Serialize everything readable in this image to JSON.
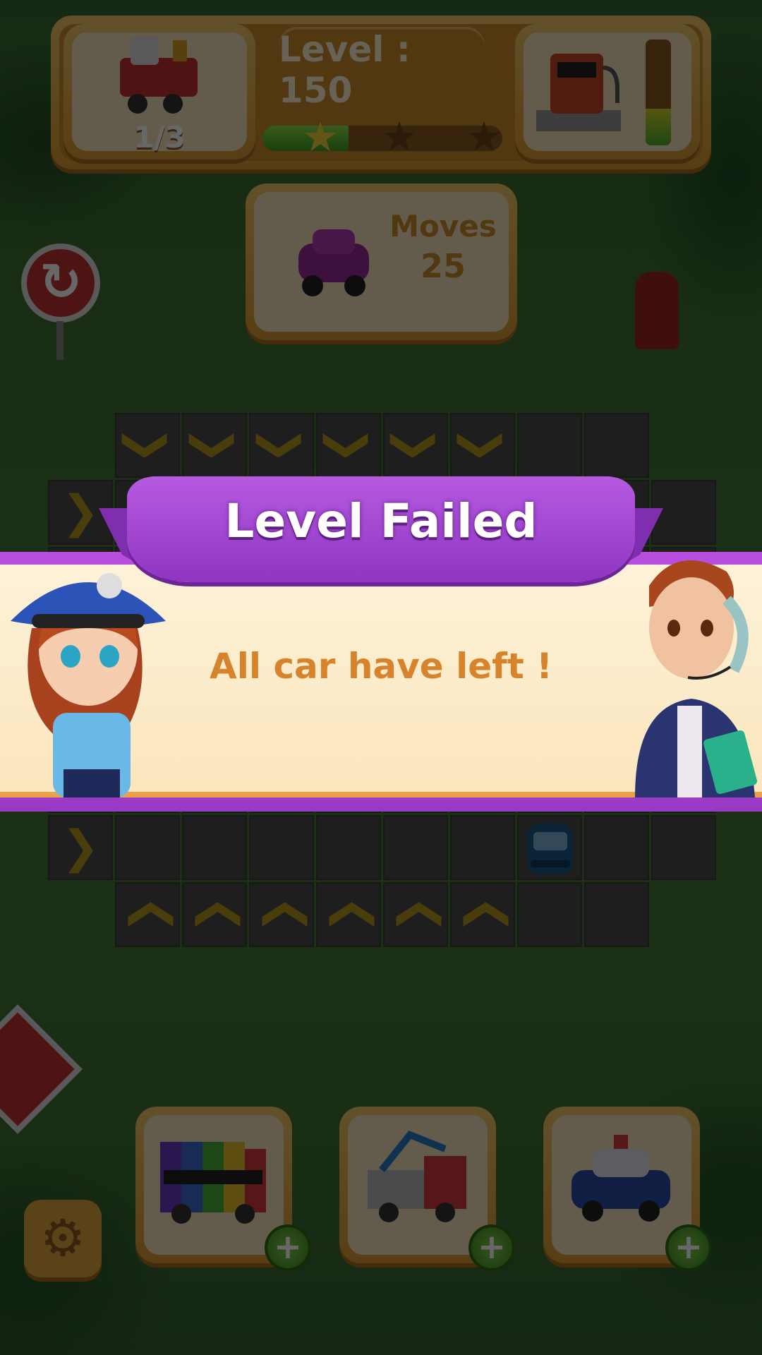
{
  "hud": {
    "train_count": "1/3",
    "level_text": "Level : 150",
    "progress": 0.36,
    "stars_earned": 1,
    "stars_total": 3,
    "fuel_level": 0.35
  },
  "moves": {
    "label": "Moves",
    "value": "25"
  },
  "banner": {
    "title": "Level Failed",
    "message": "All car have left !"
  },
  "grid": {
    "arrows_top": [
      "down",
      "down",
      "down",
      "down",
      "down",
      "down"
    ],
    "arrows_bottom": [
      "up",
      "up",
      "up",
      "up",
      "up",
      "up"
    ]
  },
  "powerups": [
    {
      "name": "rainbow-bus",
      "add_label": "+"
    },
    {
      "name": "tow-truck",
      "add_label": "+"
    },
    {
      "name": "police-car",
      "add_label": "+"
    }
  ],
  "icons": {
    "arrow_right": "❯",
    "settings": "⚙",
    "star": "★",
    "restart": "↻"
  },
  "colors": {
    "banner_purple": "#9a3ac4",
    "message_orange": "#d6832c",
    "progress_green": "#3fa021"
  }
}
